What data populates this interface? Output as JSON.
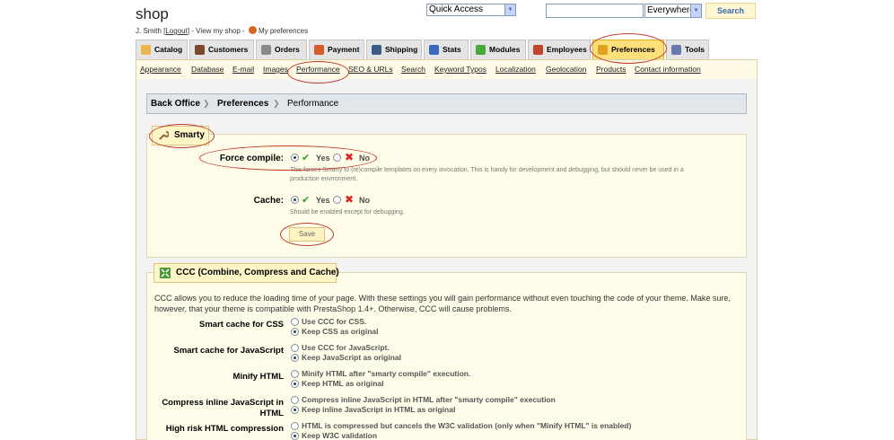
{
  "header": {
    "shop_title": "shop",
    "user_name": "J. Smith",
    "logout_link": "Logout",
    "view_shop_link": "View my shop",
    "preferences_link": "My preferences",
    "quick_access": "Quick Access",
    "search_scope": "Everywhere",
    "search_button": "Search"
  },
  "tabs": [
    {
      "label": "Catalog",
      "icon": "folder-icon",
      "color": "#e8b64a"
    },
    {
      "label": "Customers",
      "icon": "customers-icon",
      "color": "#7a4a2a"
    },
    {
      "label": "Orders",
      "icon": "orders-icon",
      "color": "#8a8a8a"
    },
    {
      "label": "Payment",
      "icon": "payment-icon",
      "color": "#d85a2a"
    },
    {
      "label": "Shipping",
      "icon": "shipping-icon",
      "color": "#3c5a8a"
    },
    {
      "label": "Stats",
      "icon": "stats-icon",
      "color": "#3a6ac0"
    },
    {
      "label": "Modules",
      "icon": "modules-icon",
      "color": "#4aa83a"
    },
    {
      "label": "Employees",
      "icon": "employees-icon",
      "color": "#c0452a"
    },
    {
      "label": "Preferences",
      "icon": "preferences-icon",
      "color": "#e0a020"
    },
    {
      "label": "Tools",
      "icon": "tools-icon",
      "color": "#6a7ab0"
    }
  ],
  "subtabs": [
    "Appearance",
    "Database",
    "E-mail",
    "Images",
    "Performance",
    "SEO & URLs",
    "Search",
    "Keyword Typos",
    "Localization",
    "Geolocation",
    "Products",
    "Contact information"
  ],
  "breadcrumb": [
    "Back Office",
    "Preferences",
    "Performance"
  ],
  "smarty": {
    "legend": "Smarty",
    "force_compile": {
      "label": "Force compile:",
      "yes": "Yes",
      "no": "No",
      "hint1": "This forces Smarty to (re)compile templates on every invocation. This is handy for development and debugging, but should never be used in a",
      "hint2": "production environment."
    },
    "cache": {
      "label": "Cache:",
      "yes": "Yes",
      "no": "No",
      "hint": "Should be enabled except for debugging."
    },
    "save": "Save"
  },
  "ccc": {
    "legend": "CCC (Combine, Compress and Cache)",
    "intro": "CCC allows you to reduce the loading time of your page. With these settings you will gain performance without even touching the code of your theme. Make sure, however, that your theme is compatible with PrestaShop 1.4+. Otherwise, CCC will cause problems.",
    "rows": [
      {
        "label": "Smart cache for CSS",
        "opt1": "Use CCC for CSS.",
        "opt2": "Keep CSS as original"
      },
      {
        "label": "Smart cache for JavaScript",
        "opt1": "Use CCC for JavaScript.",
        "opt2": "Keep JavaScript as original"
      },
      {
        "label": "Minify HTML",
        "opt1": "Minify HTML after \"smarty compile\" execution.",
        "opt2": "Keep HTML as original"
      },
      {
        "label1": "Compress inline JavaScript in",
        "label2": "HTML",
        "opt1": "Compress inline JavaScript in HTML after \"smarty compile\" execution",
        "opt2": "Keep inline JavaScript in HTML as original"
      },
      {
        "label": "High risk HTML compression",
        "opt1": "HTML is compressed but cancels the W3C validation (only when \"Minify HTML\" is enabled)",
        "opt2": "Keep W3C validation"
      }
    ]
  }
}
